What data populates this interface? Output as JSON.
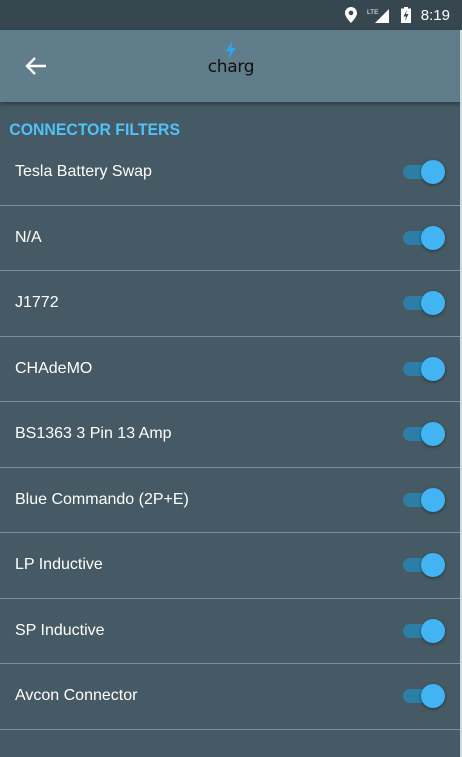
{
  "status": {
    "time": "8:19",
    "network": "LTE"
  },
  "app": {
    "logo_text": "charg",
    "accent": "#4fc3f7"
  },
  "section": {
    "title": "CONNECTOR FILTERS"
  },
  "filters": [
    {
      "label": "Tesla Battery Swap",
      "enabled": true
    },
    {
      "label": "N/A",
      "enabled": true
    },
    {
      "label": "J1772",
      "enabled": true
    },
    {
      "label": "CHAdeMO",
      "enabled": true
    },
    {
      "label": "BS1363 3 Pin 13 Amp",
      "enabled": true
    },
    {
      "label": "Blue Commando (2P+E)",
      "enabled": true
    },
    {
      "label": "LP Inductive",
      "enabled": true
    },
    {
      "label": "SP Inductive",
      "enabled": true
    },
    {
      "label": "Avcon Connector",
      "enabled": true
    }
  ]
}
